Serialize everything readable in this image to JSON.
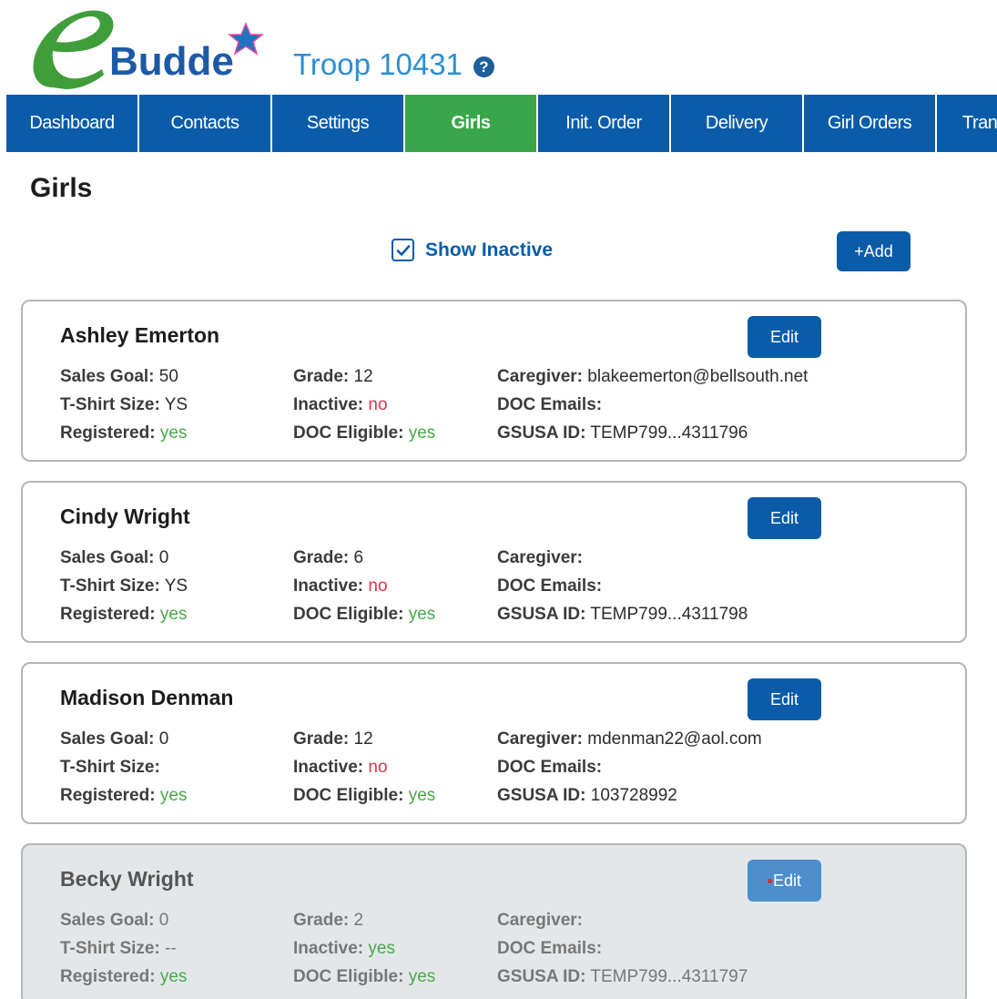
{
  "app": {
    "logo_text": "Budde",
    "troop_title": "Troop 10431",
    "help_icon": "question-circle-icon"
  },
  "nav": {
    "items": [
      {
        "label": "Dashboard"
      },
      {
        "label": "Contacts"
      },
      {
        "label": "Settings"
      },
      {
        "label": "Girls",
        "active": true
      },
      {
        "label": "Init. Order"
      },
      {
        "label": "Delivery"
      },
      {
        "label": "Girl Orders"
      },
      {
        "label": "Tran"
      }
    ]
  },
  "page": {
    "title": "Girls",
    "show_inactive_label": "Show Inactive",
    "show_inactive_checked": true,
    "add_label": "+Add"
  },
  "labels": {
    "sales_goal": "Sales Goal:",
    "tshirt": "T-Shirt Size:",
    "registered": "Registered:",
    "grade": "Grade:",
    "inactive": "Inactive:",
    "doc_eligible": "DOC Eligible:",
    "caregiver": "Caregiver:",
    "doc_emails": "DOC Emails:",
    "gsusa_id": "GSUSA ID:",
    "edit": "Edit"
  },
  "girls": [
    {
      "name": "Ashley Emerton",
      "sales_goal": "50",
      "tshirt": "YS",
      "registered": "yes",
      "grade": "12",
      "inactive": "no",
      "doc_eligible": "yes",
      "caregiver": "blakeemerton@bellsouth.net",
      "doc_emails": "",
      "gsusa_id": "TEMP799...4311796"
    },
    {
      "name": "Cindy Wright",
      "sales_goal": "0",
      "tshirt": "YS",
      "registered": "yes",
      "grade": "6",
      "inactive": "no",
      "doc_eligible": "yes",
      "caregiver": "",
      "doc_emails": "",
      "gsusa_id": "TEMP799...4311798"
    },
    {
      "name": "Madison Denman",
      "sales_goal": "0",
      "tshirt": "",
      "registered": "yes",
      "grade": "12",
      "inactive": "no",
      "doc_eligible": "yes",
      "caregiver": "mdenman22@aol.com",
      "doc_emails": "",
      "gsusa_id": "103728992"
    },
    {
      "name": "Becky Wright",
      "sales_goal": "0",
      "tshirt": "--",
      "registered": "yes",
      "grade": "2",
      "inactive": "yes",
      "doc_eligible": "yes",
      "caregiver": "",
      "doc_emails": "",
      "gsusa_id": "TEMP799...4311797"
    }
  ],
  "colors": {
    "nav_bg": "#0b5ca8",
    "nav_active": "#3aa64b",
    "title_blue": "#2a8fd1",
    "yes_green": "#49a84a",
    "no_red": "#e2334b",
    "inactive_card_bg": "#e3e7ea"
  }
}
